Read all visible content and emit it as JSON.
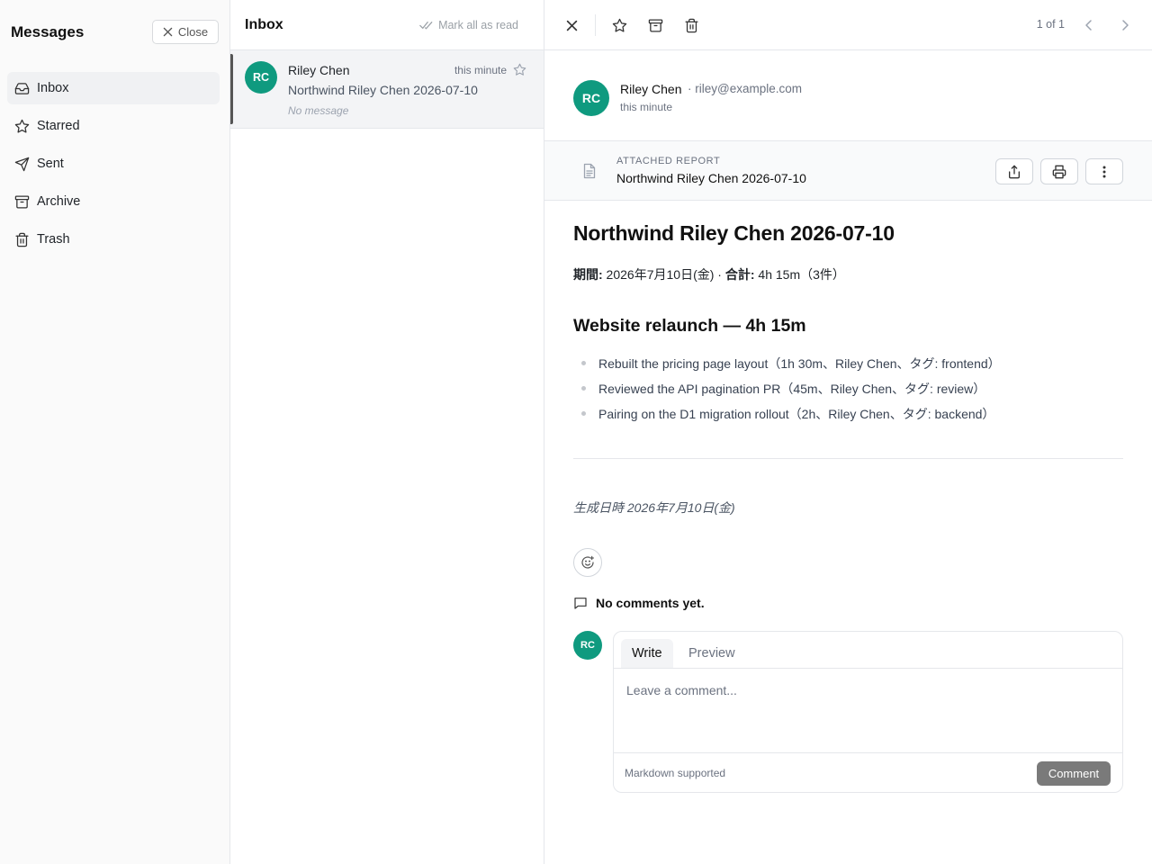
{
  "sidebar": {
    "title": "Messages",
    "close_label": "Close",
    "items": [
      {
        "label": "Inbox",
        "icon": "inbox-icon",
        "active": true
      },
      {
        "label": "Starred",
        "icon": "star-icon"
      },
      {
        "label": "Sent",
        "icon": "send-icon"
      },
      {
        "label": "Archive",
        "icon": "archive-icon"
      },
      {
        "label": "Trash",
        "icon": "trash-icon"
      }
    ]
  },
  "inbox": {
    "title": "Inbox",
    "mark_all_label": "Mark all as read",
    "messages": [
      {
        "initials": "RC",
        "sender": "Riley Chen",
        "time": "this minute",
        "subject": "Northwind Riley Chen 2026-07-10",
        "preview": "No message"
      }
    ]
  },
  "reader": {
    "pager": "1 of 1",
    "from": {
      "initials": "RC",
      "name": "Riley Chen",
      "email": "· riley@example.com",
      "time": "this minute"
    },
    "attachment": {
      "label": "ATTACHED REPORT",
      "title": "Northwind Riley Chen 2026-07-10"
    },
    "doc": {
      "title": "Northwind Riley Chen 2026-07-10",
      "period_label": "期間:",
      "period_value": " 2026年7月10日(金) · ",
      "total_label": "合計:",
      "total_value": " 4h 15m（3件）",
      "section_title": "Website relaunch — 4h 15m",
      "items": [
        "Rebuilt the pricing page layout（1h 30m、Riley Chen、タグ: frontend）",
        "Reviewed the API pagination PR（45m、Riley Chen、タグ: review）",
        "Pairing on the D1 migration rollout（2h、Riley Chen、タグ: backend）"
      ],
      "generated": "生成日時 2026年7月10日(金)"
    },
    "comments": {
      "empty_label": "No comments yet.",
      "avatar_initials": "RC",
      "write_tab": "Write",
      "preview_tab": "Preview",
      "placeholder": "Leave a comment...",
      "markdown_note": "Markdown supported",
      "submit_label": "Comment"
    }
  },
  "colors": {
    "avatar": "#0f9a7f",
    "comment_button": "#7a7a7a"
  }
}
